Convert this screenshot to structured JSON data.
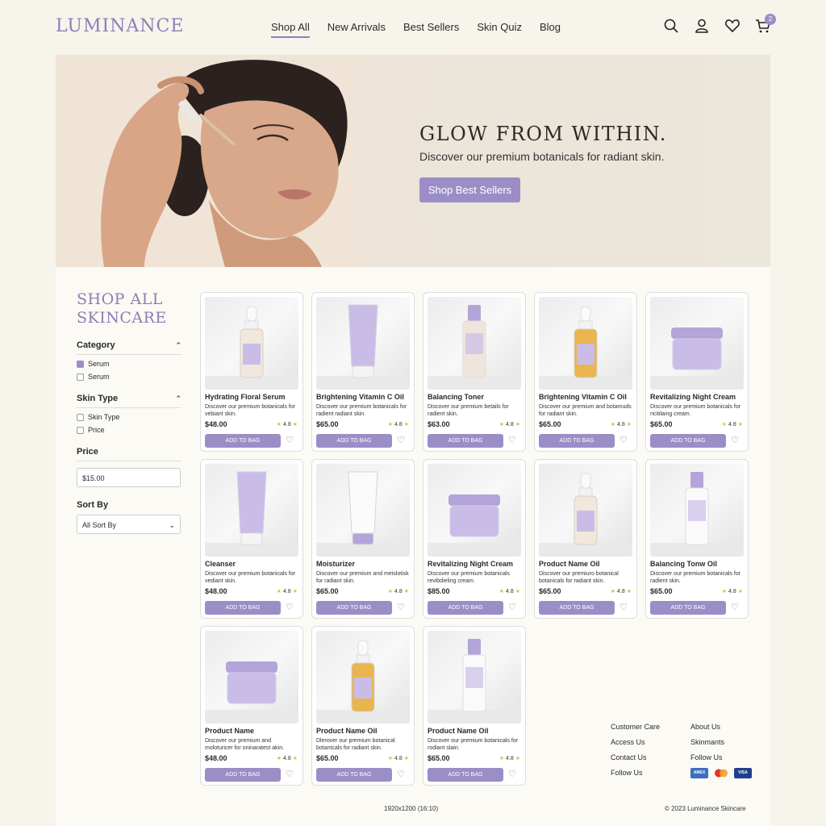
{
  "header": {
    "logo": "LUMINANCE",
    "nav": [
      "Shop All",
      "New Arrivals",
      "Best Sellers",
      "Skin Quiz",
      "Blog"
    ],
    "cart_count": "2",
    "icons": [
      "search-icon",
      "account-icon",
      "heart-icon",
      "cart-icon"
    ]
  },
  "hero": {
    "title": "GLOW FROM WITHIN.",
    "subtitle": "Discover our premium botanicals for radiant skin.",
    "cta": "Shop Best Sellers"
  },
  "sidebar": {
    "title_line1": "SHOP ALL",
    "title_line2": "SKINCARE",
    "category": {
      "label": "Category",
      "options": [
        {
          "label": "Serum",
          "checked": true
        },
        {
          "label": "Serum",
          "checked": false
        }
      ]
    },
    "skin_type": {
      "label": "Skin Type",
      "options": [
        {
          "label": "Skin Type",
          "checked": false
        },
        {
          "label": "Price",
          "checked": false
        }
      ]
    },
    "price": {
      "label": "Price",
      "value": "$15.00"
    },
    "sort": {
      "label": "Sort By",
      "value": "All Sort By"
    }
  },
  "products": [
    {
      "name": "Hydrating Floral Serum",
      "desc": "Discover our premium botanicals for vebiant skin.",
      "price": "$48.00",
      "rating": "4.8",
      "button": "ADD TO BAG",
      "type": "dropper-clear"
    },
    {
      "name": "Brightening Vitamin C Oil",
      "desc": "Discover our premium botanicals for radient radiant skin.",
      "price": "$65.00",
      "rating": "4.8",
      "button": "ADD TO BAG",
      "type": "tube-purple"
    },
    {
      "name": "Balancing Toner",
      "desc": "Discover our premium betails for radient skin.",
      "price": "$63.00",
      "rating": "4.8",
      "button": "ADD TO BAG",
      "type": "bottle-clear"
    },
    {
      "name": "Brightening Vitamin C Oil",
      "desc": "Discover our premium and botamuds for radiant skin.",
      "price": "$65.00",
      "rating": "4.8",
      "button": "ADD TO BAG",
      "type": "dropper-amber"
    },
    {
      "name": "Revitalizing Night Cream",
      "desc": "Discover our premium botanicals for ricitilaing cream.",
      "price": "$65.00",
      "rating": "4.8",
      "button": "ADD TO BAG",
      "type": "jar"
    },
    {
      "name": "Cleanser",
      "desc": "Discover our premium botanicals for vediant skin.",
      "price": "$48.00",
      "rating": "4.8",
      "button": "ADD TO BAG",
      "type": "tube-purple"
    },
    {
      "name": "Moisturizer",
      "desc": "Discover our premium and meislotisk for radiant skin.",
      "price": "$65.00",
      "rating": "4.8",
      "button": "ADD TO BAG",
      "type": "tube-white"
    },
    {
      "name": "Revitalizing Night Cream",
      "desc": "Discover our premium botanicals revibdieling cream.",
      "price": "$85.00",
      "rating": "4.8",
      "button": "ADD TO BAG",
      "type": "jar"
    },
    {
      "name": "Product Name Oil",
      "desc": "Discover our premiuro botanical botanicals for radiant skin.",
      "price": "$65.00",
      "rating": "4.8",
      "button": "ADD TO BAG",
      "type": "dropper-clear"
    },
    {
      "name": "Balancing Tonw Oil",
      "desc": "Discover our premium botanicals for radient skin.",
      "price": "$65.00",
      "rating": "4.8",
      "button": "ADD TO BAG",
      "type": "bottle-white"
    },
    {
      "name": "Product Name",
      "desc": "Discover our premium and moloturicer for oninaratest akin.",
      "price": "$48.00",
      "rating": "4.8",
      "button": "ADD TO BAG",
      "type": "jar"
    },
    {
      "name": "Product Name Oil",
      "desc": "Dlerover our premium botanical botantcals for radiant skin.",
      "price": "$65.00",
      "rating": "4.8",
      "button": "ADD TO BAG",
      "type": "dropper-amber"
    },
    {
      "name": "Product Name Oil",
      "desc": "Discover our premium botanicals for rodiant slain.",
      "price": "$65.00",
      "rating": "4.8",
      "button": "ADD TO BAG",
      "type": "bottle-white"
    }
  ],
  "footer": {
    "col1": [
      "Customer Care",
      "Access Us",
      "Contact Us",
      "Follow Us"
    ],
    "col2": [
      "About Us",
      "Skinmants",
      "Follow Us"
    ],
    "payments": [
      "AMEX",
      "MC",
      "VISA"
    ],
    "resolution_note": "1920x1200 (16:10)",
    "copyright": "© 2023 Luminance Skincare"
  },
  "colors": {
    "accent": "#9b8ec7",
    "logo": "#8c7fb5",
    "background": "#f7f4ec"
  }
}
